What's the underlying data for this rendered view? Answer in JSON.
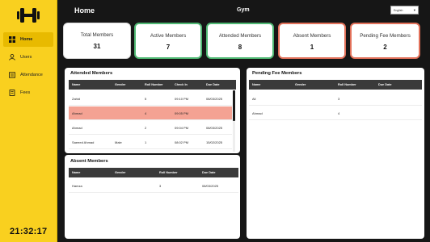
{
  "sidebar": {
    "items": [
      {
        "label": "Home",
        "icon": "dashboard-icon"
      },
      {
        "label": "Users",
        "icon": "users-icon"
      },
      {
        "label": "Attendance",
        "icon": "attendance-icon"
      },
      {
        "label": "Fees",
        "icon": "fees-icon"
      }
    ],
    "clock": "21:32:17"
  },
  "header": {
    "title": "Home",
    "center": "Gym",
    "language": "English"
  },
  "cards": [
    {
      "label": "Total Members",
      "value": "31"
    },
    {
      "label": "Active Members",
      "value": "7"
    },
    {
      "label": "Attended Members",
      "value": "8"
    },
    {
      "label": "Absent Members",
      "value": "1"
    },
    {
      "label": "Pending Fee Members",
      "value": "2"
    }
  ],
  "attended": {
    "title": "Attended Members",
    "columns": [
      "Name",
      "Gender",
      "Roll Number",
      "Check In",
      "Due Date"
    ],
    "rows": [
      [
        "Zahid",
        "",
        "5",
        "09:10 PM",
        "08/03/2025"
      ],
      [
        "Ahmad",
        "",
        "4",
        "09:05 PM",
        ""
      ],
      [
        "Ahmad",
        "",
        "2",
        "09:04 PM",
        "08/03/2025"
      ],
      [
        "Saeeed Ahmad",
        "Male",
        "1",
        "08:02 PM",
        "15/02/2025"
      ]
    ]
  },
  "absent": {
    "title": "Absent Members",
    "columns": [
      "Name",
      "Gender",
      "Roll Number",
      "Due Date"
    ],
    "rows": [
      [
        "Hamza",
        "",
        "3",
        "08/03/2025"
      ]
    ]
  },
  "pending": {
    "title": "Pending Fee Members",
    "columns": [
      "Name",
      "Gender",
      "Roll Number",
      "Due Date"
    ],
    "rows": [
      [
        "Ali",
        "",
        "3",
        ""
      ],
      [
        "Ahmad",
        "",
        "4",
        ""
      ]
    ]
  },
  "colors": {
    "sidebar": "#f9d01f",
    "active_nav": "#e8ba00",
    "green_border": "#4fb873",
    "red_border": "#e2715a",
    "highlight_row": "#f4a293",
    "table_header": "#3a3a3a"
  }
}
